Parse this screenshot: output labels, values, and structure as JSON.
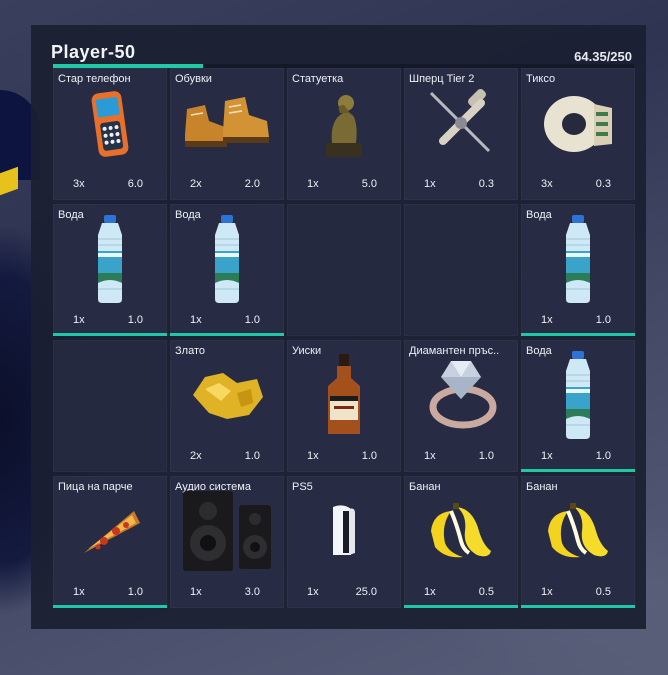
{
  "header": {
    "player_name": "Player-50",
    "weight_text": "64.35/250",
    "weight_fraction": 0.2574
  },
  "slots": [
    {
      "label": "Стар телефон",
      "qty": "3x",
      "weight": "6.0",
      "icon": "old-phone-icon",
      "durability": false
    },
    {
      "label": "Обувки",
      "qty": "2x",
      "weight": "2.0",
      "icon": "boots-icon",
      "durability": false
    },
    {
      "label": "Статуетка",
      "qty": "1x",
      "weight": "5.0",
      "icon": "statue-icon",
      "durability": false
    },
    {
      "label": "Шперц Tier 2",
      "qty": "1x",
      "weight": "0.3",
      "icon": "lockpick-icon",
      "durability": false
    },
    {
      "label": "Тиксо",
      "qty": "3x",
      "weight": "0.3",
      "icon": "tape-icon",
      "durability": false
    },
    {
      "label": "Вода",
      "qty": "1x",
      "weight": "1.0",
      "icon": "water-bottle-icon",
      "durability": true
    },
    {
      "label": "Вода",
      "qty": "1x",
      "weight": "1.0",
      "icon": "water-bottle-icon",
      "durability": true
    },
    {
      "empty": true
    },
    {
      "empty": true
    },
    {
      "label": "Вода",
      "qty": "1x",
      "weight": "1.0",
      "icon": "water-bottle-icon",
      "durability": true
    },
    {
      "empty": true
    },
    {
      "label": "Злато",
      "qty": "2x",
      "weight": "1.0",
      "icon": "gold-nugget-icon",
      "durability": false
    },
    {
      "label": "Уиски",
      "qty": "1x",
      "weight": "1.0",
      "icon": "whiskey-icon",
      "durability": false
    },
    {
      "label": "Диамантен пръс..",
      "qty": "1x",
      "weight": "1.0",
      "icon": "diamond-ring-icon",
      "durability": false
    },
    {
      "label": "Вода",
      "qty": "1x",
      "weight": "1.0",
      "icon": "water-bottle-icon",
      "durability": true
    },
    {
      "label": "Пица на парче",
      "qty": "1x",
      "weight": "1.0",
      "icon": "pizza-slice-icon",
      "durability": true
    },
    {
      "label": "Аудио система",
      "qty": "1x",
      "weight": "3.0",
      "icon": "speakers-icon",
      "durability": false
    },
    {
      "label": "PS5",
      "qty": "1x",
      "weight": "25.0",
      "icon": "ps5-icon",
      "durability": false
    },
    {
      "label": "Банан",
      "qty": "1x",
      "weight": "0.5",
      "icon": "banana-icon",
      "durability": true
    },
    {
      "label": "Банан",
      "qty": "1x",
      "weight": "0.5",
      "icon": "banana-icon",
      "durability": true
    }
  ],
  "colors": {
    "accent": "#22c9a6",
    "slot": "#272c44",
    "panel": "#1b1f31"
  }
}
